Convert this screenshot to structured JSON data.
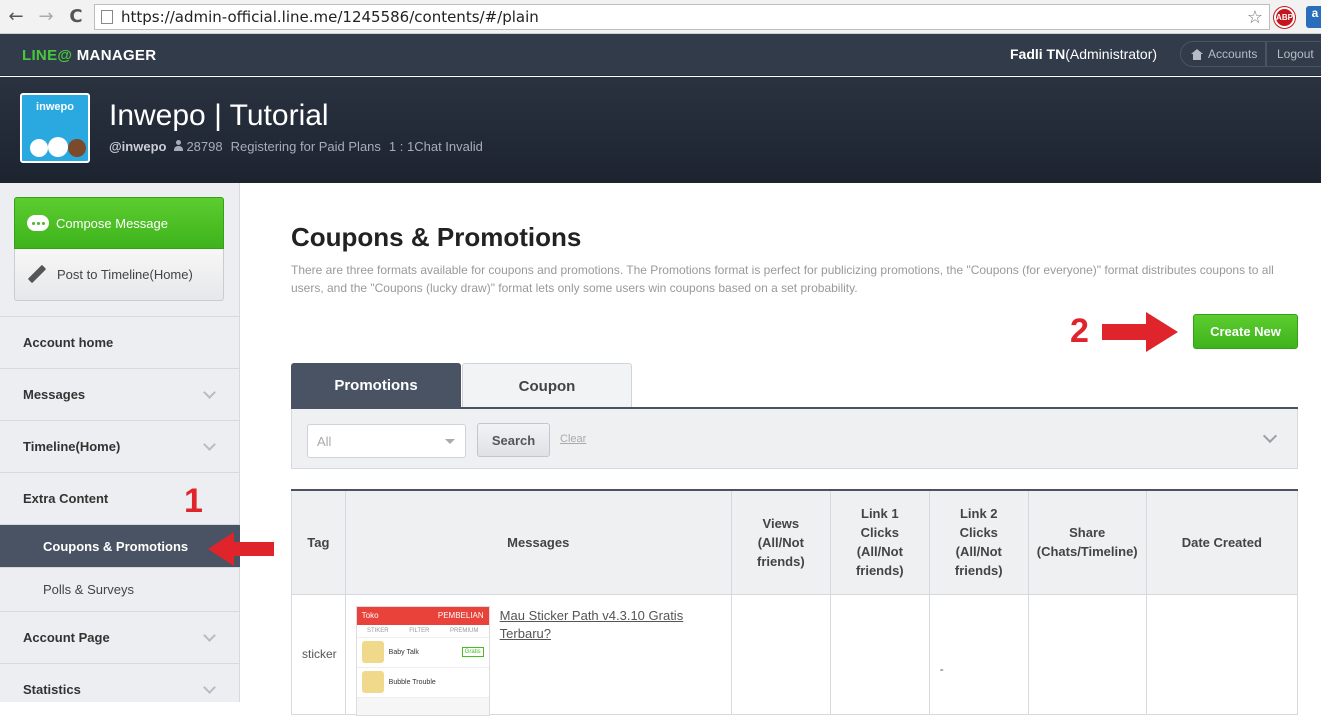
{
  "browser": {
    "back": "←",
    "forward": "→",
    "reload": "C",
    "url": "https://admin-official.line.me/1245586/contents/#/plain",
    "star": "☆",
    "abp": "ABP",
    "ext": "a"
  },
  "topnav": {
    "logo_line": "LINE@",
    "logo_rest": " MANAGER",
    "user": "Fadli TN",
    "role": "(Administrator)",
    "accounts": "Accounts",
    "logout": "Logout"
  },
  "header": {
    "avatar_brand": "inwepo",
    "title": "Inwepo | Tutorial",
    "handle": "@inwepo",
    "friends": "28798",
    "plan": "Registering for Paid Plans",
    "chat": "1 : 1Chat Invalid"
  },
  "sidebar": {
    "compose": "Compose Message",
    "post": "Post to Timeline(Home)",
    "items": [
      {
        "label": "Account home"
      },
      {
        "label": "Messages"
      },
      {
        "label": "Timeline(Home)"
      },
      {
        "label": "Extra Content"
      },
      {
        "label": "Coupons & Promotions"
      },
      {
        "label": "Polls & Surveys"
      },
      {
        "label": "Account Page"
      },
      {
        "label": "Statistics"
      }
    ]
  },
  "annotations": {
    "one": "1",
    "two": "2"
  },
  "main": {
    "title": "Coupons & Promotions",
    "description": "There are three formats available for coupons and promotions. The Promotions format is perfect for publicizing promotions, the \"Coupons (for everyone)\" format distributes coupons to all users, and the \"Coupons (lucky draw)\" format lets only some users win coupons based on a set probability.",
    "create_new": "Create New",
    "tabs": [
      {
        "label": "Promotions"
      },
      {
        "label": "Coupon"
      }
    ],
    "filter": {
      "selected": "All",
      "search": "Search",
      "clear": "Clear"
    },
    "table": {
      "headers": [
        "Tag",
        "Messages",
        "Views (All/Not friends)",
        "Link 1 Clicks (All/Not friends)",
        "Link 2 Clicks (All/Not friends)",
        "Share (Chats/Timeline)",
        "Date Created"
      ],
      "rows": [
        {
          "tag": "sticker",
          "message": "Mau Sticker Path v4.3.10 Gratis Terbaru?",
          "views": "",
          "link1": "",
          "link2": "-",
          "share": "",
          "date": "",
          "thumb": {
            "store": "Toko",
            "action": "PEMBELIAN",
            "tabs": [
              "STIKER",
              "FILTER",
              "PREMIUM"
            ],
            "item1": "Baby Talk",
            "item1_badge": "Gratis",
            "item2": "Bubble Trouble"
          }
        }
      ]
    }
  }
}
